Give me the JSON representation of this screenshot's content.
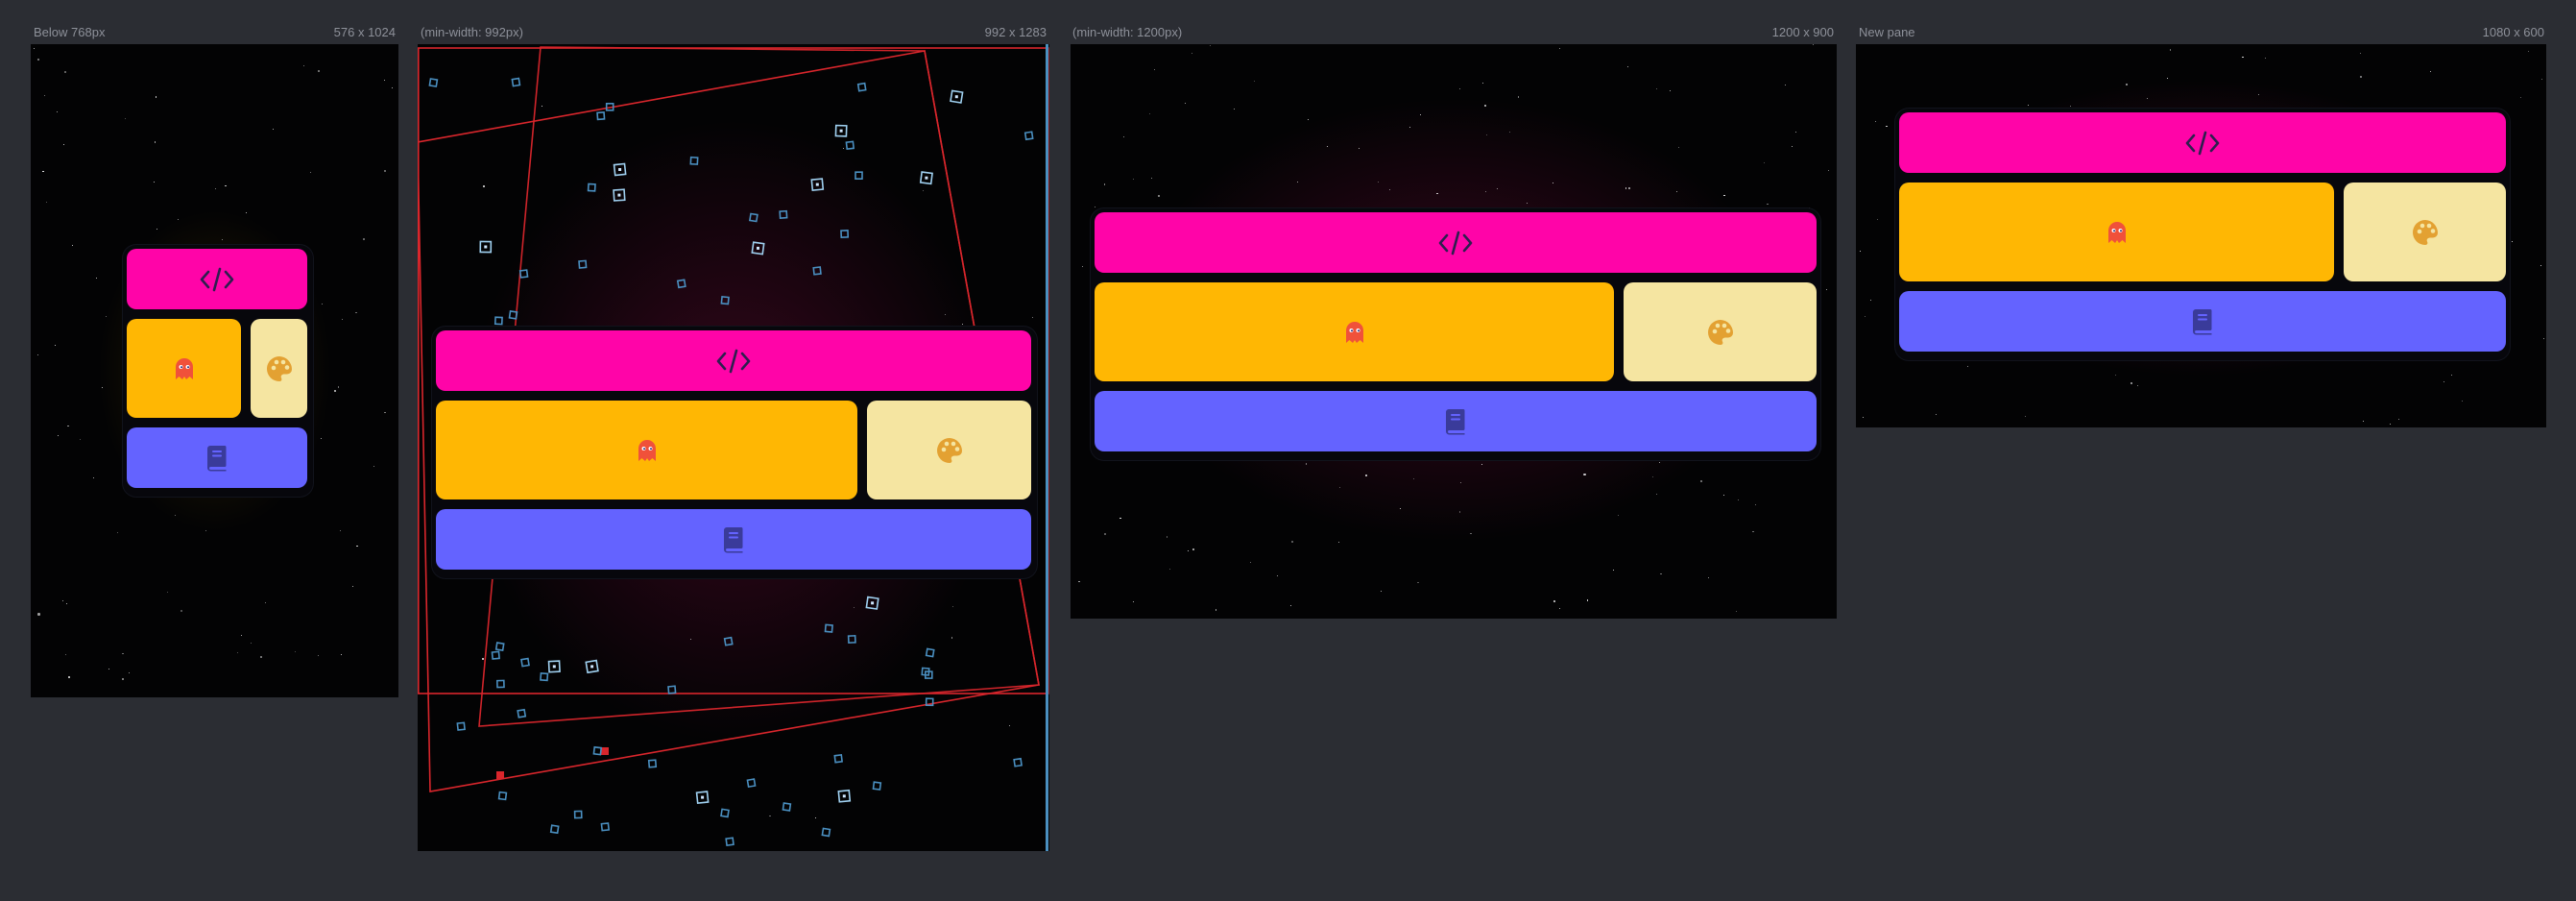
{
  "panes": [
    {
      "id": "small",
      "label": "Below 768px",
      "dims": "576 x 1024"
    },
    {
      "id": "medium",
      "label": "(min-width: 992px)",
      "dims": "992 x 1283"
    },
    {
      "id": "large",
      "label": "(min-width: 1200px)",
      "dims": "1200 x 900"
    },
    {
      "id": "new",
      "label": "New pane",
      "dims": "1080 x 600"
    }
  ],
  "tiles": {
    "code": {
      "icon": "code-icon",
      "color": "#ff04a8"
    },
    "ghost": {
      "icon": "ghost-icon",
      "color": "#ffb703"
    },
    "palette": {
      "icon": "palette-icon",
      "color": "#f5e5a1"
    },
    "book": {
      "icon": "book-icon",
      "color": "#6463ff"
    }
  },
  "icon_colors": {
    "code": "#2e1f4f",
    "ghost": "#f0513a",
    "palette": "#e3a132",
    "book": "#3a3b9a"
  }
}
